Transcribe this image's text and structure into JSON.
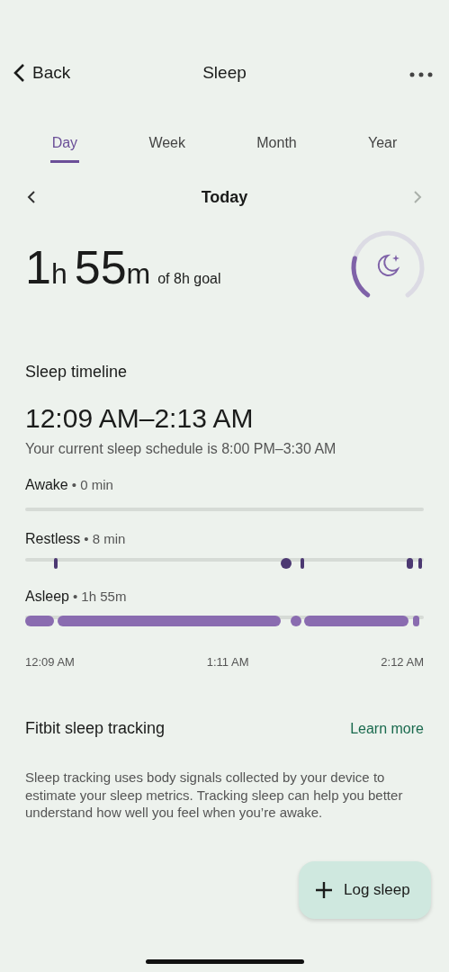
{
  "header": {
    "back": "Back",
    "title": "Sleep"
  },
  "tabs": [
    {
      "label": "Day",
      "selected": true
    },
    {
      "label": "Week",
      "selected": false
    },
    {
      "label": "Month",
      "selected": false
    },
    {
      "label": "Year",
      "selected": false
    }
  ],
  "date_nav": {
    "label": "Today",
    "next_disabled": true
  },
  "summary": {
    "hours": "1",
    "hours_unit": "h",
    "minutes": "55",
    "minutes_unit": "m",
    "goal": "of 8h goal",
    "level": 0.24
  },
  "timeline": {
    "title": "Sleep timeline",
    "range": "12:09 AM–2:13 AM",
    "schedule": "Your current sleep schedule is 8:00 PM–3:30 AM",
    "stages": [
      {
        "kind": "awake",
        "name": "Awake",
        "duration": "• 0 min"
      },
      {
        "kind": "restless",
        "name": "Restless",
        "duration": "• 8 min"
      },
      {
        "kind": "asleep",
        "name": "Asleep",
        "duration": "• 1h 55m"
      }
    ],
    "axis": [
      "12:09 AM",
      "1:11 AM",
      "2:12 AM"
    ]
  },
  "tracking": {
    "title": "Fitbit sleep tracking",
    "link": "Learn more",
    "body": "Sleep tracking uses body signals collected by your device to estimate your sleep metrics. Tracking sleep can help you better understand how well you feel when you’re awake."
  },
  "fab": {
    "label": "Log sleep"
  }
}
